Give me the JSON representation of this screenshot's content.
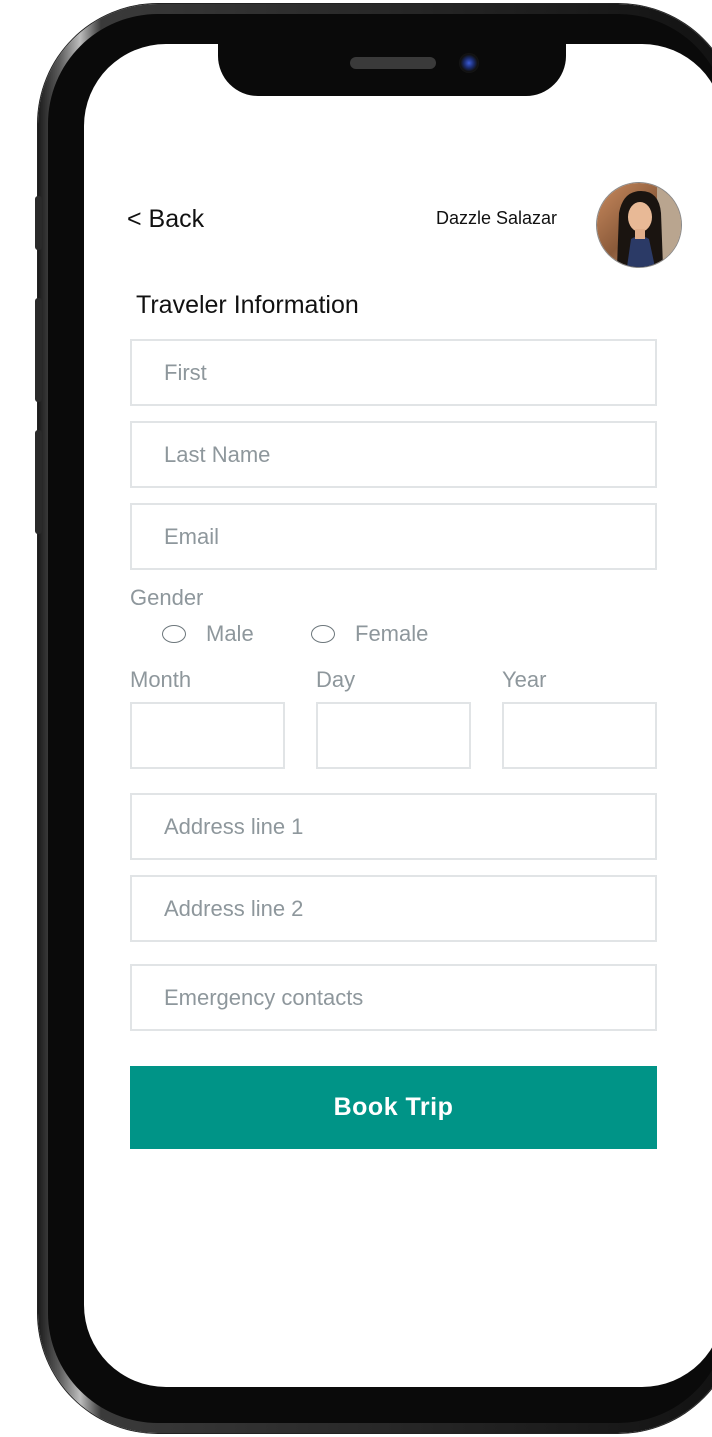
{
  "header": {
    "back_label": "< Back",
    "user_name": "Dazzle Salazar",
    "avatar_icon": "user-avatar"
  },
  "form": {
    "title": "Traveler Information",
    "first_placeholder": "First",
    "last_name_placeholder": "Last Name",
    "email_placeholder": "Email",
    "gender_label": "Gender",
    "gender_options": [
      "Male",
      "Female"
    ],
    "month_label": "Month",
    "day_label": "Day",
    "year_label": "Year",
    "address1_placeholder": "Address line 1",
    "address2_placeholder": "Address line 2",
    "emergency_placeholder": "Emergency contacts",
    "submit_label": "Book Trip"
  },
  "colors": {
    "accent": "#009487",
    "placeholder": "#8e979c",
    "border": "#e1e4e6"
  }
}
